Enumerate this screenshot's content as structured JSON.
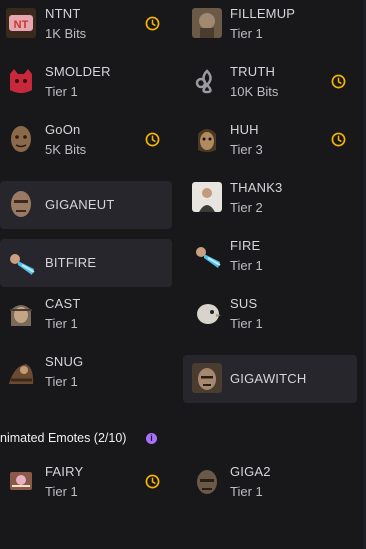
{
  "accent": "#f7b500",
  "info_color": "#a970ff",
  "emotes": [
    {
      "name": "NTNT",
      "sub": "1K Bits",
      "clock": true
    },
    {
      "name": "FILLEMUP",
      "sub": "Tier 1",
      "clock": false
    },
    {
      "name": "SMOLDER",
      "sub": "Tier 1",
      "clock": false
    },
    {
      "name": "TRUTH",
      "sub": "10K Bits",
      "clock": true
    },
    {
      "name": "GoOn",
      "sub": "5K Bits",
      "clock": true
    },
    {
      "name": "HUH",
      "sub": "Tier 3",
      "clock": true
    },
    {
      "name": "GIGANEUT",
      "sub": "",
      "clock": false,
      "selected": true
    },
    {
      "name": "THANK3",
      "sub": "Tier 2",
      "clock": false
    },
    {
      "name": "BITFIRE",
      "sub": "",
      "clock": false,
      "selected": true
    },
    {
      "name": "FIRE",
      "sub": "Tier 1",
      "clock": false
    },
    {
      "name": "CAST",
      "sub": "Tier 1",
      "clock": false
    },
    {
      "name": "SUS",
      "sub": "Tier 1",
      "clock": false
    },
    {
      "name": "SNUG",
      "sub": "Tier 1",
      "clock": false
    },
    {
      "name": "GIGAWITCH",
      "sub": "",
      "clock": false,
      "selected": true
    }
  ],
  "animated_section": {
    "title": "nimated Emotes (2/10)",
    "info_icon": "i"
  },
  "animated": [
    {
      "name": "FAIRY",
      "sub": "Tier 1",
      "clock": true
    },
    {
      "name": "GIGA2",
      "sub": "Tier 1",
      "clock": false
    }
  ]
}
